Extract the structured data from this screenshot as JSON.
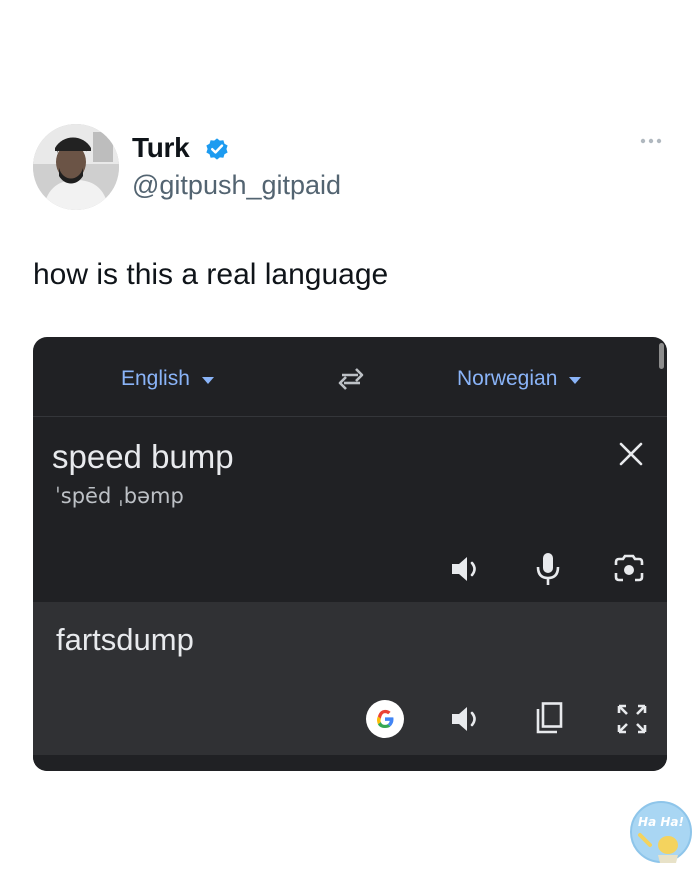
{
  "tweet": {
    "display_name": "Turk",
    "handle": "@gitpush_gitpaid",
    "text": "how is this a real language",
    "verified": true,
    "icons": {
      "verified": "verified-badge-icon",
      "more": "more-options-icon"
    },
    "accent_color": "#1d9bf0"
  },
  "translate": {
    "source_language": "English",
    "target_language": "Norwegian",
    "source_text": "speed bump",
    "phonetic": "ˈspēd ˌbəmp",
    "result_text": "fartsdump",
    "link_color": "#8ab4f8",
    "icons": {
      "swap": "swap-languages-icon",
      "clear": "close-icon",
      "listen": "speaker-icon",
      "mic": "microphone-icon",
      "camera": "camera-translate-icon",
      "google": "google-logo-icon",
      "copy": "copy-icon",
      "fullscreen": "fullscreen-icon",
      "caret": "caret-down-icon"
    }
  },
  "watermark": {
    "text": "Ha Ha!"
  }
}
